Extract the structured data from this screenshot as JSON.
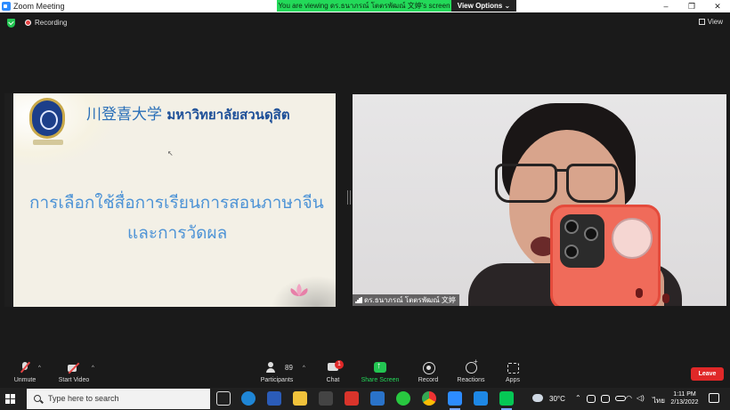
{
  "window": {
    "title": "Zoom Meeting",
    "viewing_banner": "You are viewing ดร.ธนาภรณ์ โตตรพัฒณ์ 文婷's screen",
    "view_options": "View Options ⌄",
    "minimize": "–",
    "restore": "❐",
    "close": "✕"
  },
  "meeting": {
    "recording_label": "Recording",
    "view_label": "View"
  },
  "slide": {
    "header_cn": "川登喜大学",
    "header_th": "มหาวิทยาลัยสวนดุสิต",
    "title_line1": "การเลือกใช้สื่อการเรียนการสอนภาษาจีน",
    "title_line2": "และการวัดผล"
  },
  "participant": {
    "name": "ดร.ธนาภรณ์ โตตรพัฒณ์ 文婷"
  },
  "controls": {
    "unmute": "Unmute",
    "start_video": "Start Video",
    "participants": "Participants",
    "participant_count": "89",
    "chat": "Chat",
    "chat_badge": "1",
    "share_screen": "Share Screen",
    "record": "Record",
    "reactions": "Reactions",
    "apps": "Apps",
    "leave": "Leave",
    "caret": "^"
  },
  "taskbar": {
    "search_placeholder": "Type here to search",
    "temperature": "30°C",
    "language": "ไทย",
    "time": "1:11 PM",
    "date": "2/13/2022"
  },
  "colors": {
    "share_green": "#23c552",
    "leave_red": "#e02828",
    "banner_green": "#23d959"
  }
}
